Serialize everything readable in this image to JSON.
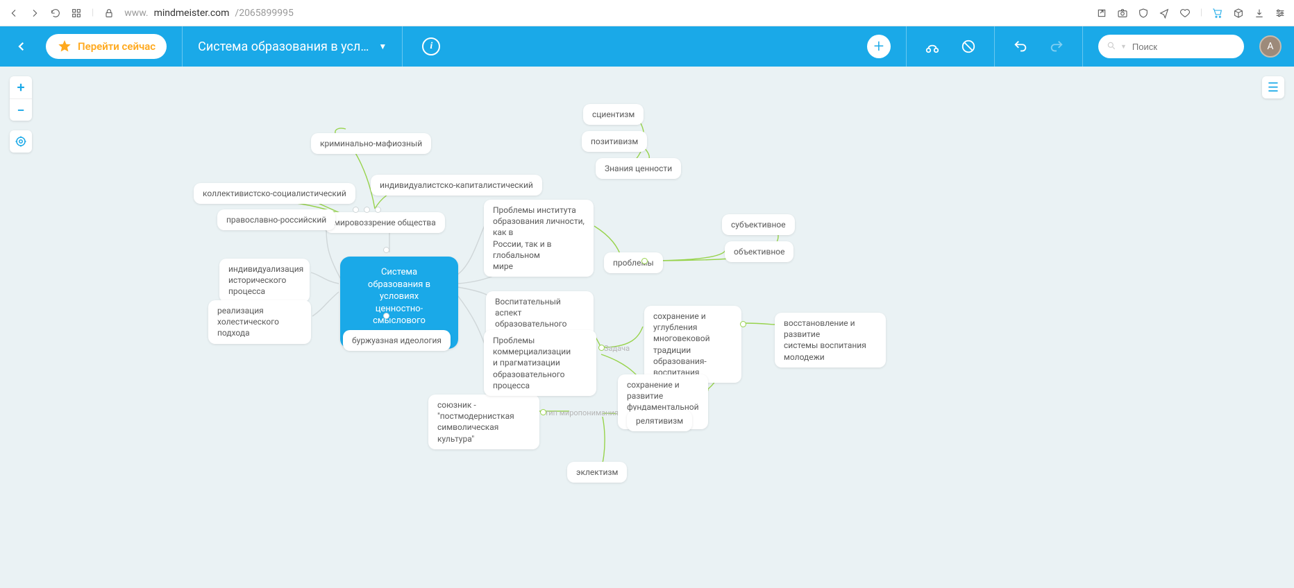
{
  "browser": {
    "url_grey1": "www.",
    "url_domain": "mindmeister.com",
    "url_grey2": "/2065899995"
  },
  "topbar": {
    "cta": "Перейти сейчас",
    "title": "Система образования в усл…",
    "search_placeholder": "Поиск",
    "avatar_initial": "А"
  },
  "floating": {
    "task": "Задача",
    "worldview": "тип миропонимания"
  },
  "nodes": {
    "root": "Система образования в\nусловиях\nценностно-смыслового\nкризиса",
    "mirov": "мировоззрение общества",
    "kollekt": "коллективистско-социалистический",
    "pravosl": "православно-российский",
    "krim": "криминально-мафиозный",
    "indiv_cap": "индивидуалистско-капиталистический",
    "indiv_hist": "индивидуализация\nисторического процесса",
    "holist": "реализация холестического\nподхода",
    "burzh": "буржуазная идеология",
    "soyuz": "союзник - \"постмодернисткая\nсимволическая культура\"",
    "problems_inst": "Проблемы института\nобразования личности, как в\nРоссии, так и в глобальном\nмире",
    "vosp_aspect": "Воспитательный аспект\nобразовательного процесса",
    "problems_comm": "Проблемы коммерциализации\nи прагматизации\nобразовательного процесса",
    "znaniya": "Знания ценности",
    "scient": "сциентизм",
    "positiv": "позитивизм",
    "problemy": "проблемы",
    "subj": "субъективное",
    "obj": "объективное",
    "sohr_trad": "сохранение и углубления\nмноговековой традиции\nобразования-воспитания",
    "vosst": "восстановление и развитие\nсистемы воспитания молодежи",
    "sohr_nauki": "сохранение и развитие\nфундаментальной науки",
    "relat": "релятивизм",
    "eklekt": "эклектизм"
  }
}
